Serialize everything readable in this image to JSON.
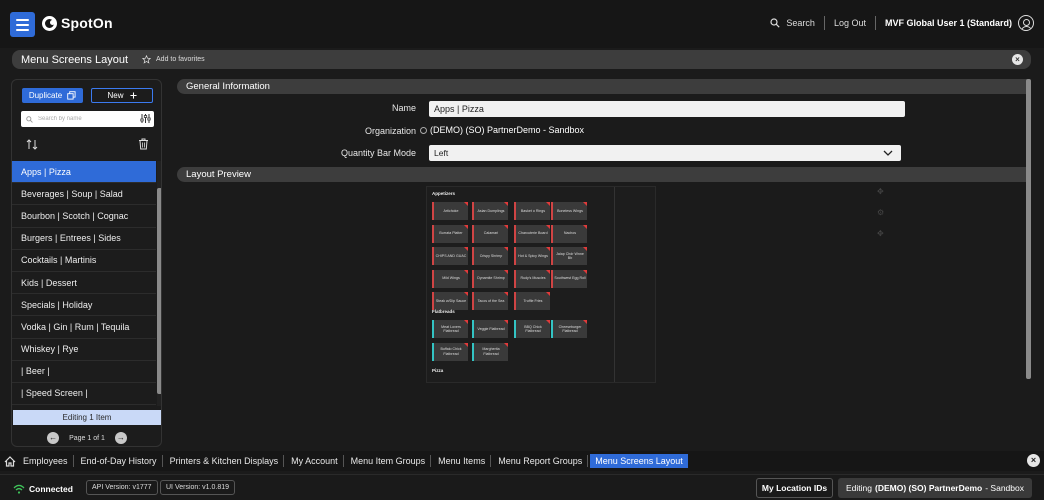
{
  "header": {
    "brand": "SpotOn",
    "search_label": "Search",
    "logout_label": "Log Out",
    "user_name": "MVF Global User 1 (Standard)"
  },
  "titlebar": {
    "title": "Menu Screens Layout",
    "favorites_label": "Add to favorites"
  },
  "sidebar": {
    "duplicate_label": "Duplicate",
    "new_label": "New",
    "search_placeholder": "Search by name",
    "items": [
      {
        "label": "Apps | Pizza",
        "active": true
      },
      {
        "label": "Beverages | Soup | Salad"
      },
      {
        "label": "Bourbon | Scotch | Cognac"
      },
      {
        "label": "Burgers | Entrees | Sides"
      },
      {
        "label": "Cocktails | Martinis"
      },
      {
        "label": "Kids | Dessert"
      },
      {
        "label": "Specials | Holiday"
      },
      {
        "label": "Vodka | Gin | Rum | Tequila"
      },
      {
        "label": "Whiskey | Rye"
      },
      {
        "label": "| Beer |"
      },
      {
        "label": "| Speed Screen |"
      }
    ],
    "editing_label": "Editing 1 Item",
    "pager_label": "Page 1 of 1"
  },
  "general": {
    "section_title": "General Information",
    "name_label": "Name",
    "name_value": "Apps | Pizza",
    "org_label": "Organization",
    "org_value": "(DEMO) (SO) PartnerDemo - Sandbox",
    "qty_label": "Quantity Bar Mode",
    "qty_value": "Left"
  },
  "preview": {
    "section_title": "Layout Preview",
    "groups": [
      {
        "heading": "Appetizers",
        "buttons": [
          "Artichoke",
          "Asian Dumplings",
          "Basket o Rings",
          "Boneless Wings",
          "Burrata Platter",
          "Calamari",
          "Charcuterie Board",
          "Nachos",
          "CHIPS AND GUAC",
          "Crispy Shrimp",
          "Hot & Spicy Wings",
          "Jalap Chdr Wnne Bb",
          "Mild Wings",
          "Dynamite Shrimp",
          "Rudy's Muscles",
          "Southwest Egg Roll",
          "Steak w/Dip Sauce",
          "Tacos of the Sea",
          "Truffle Fries"
        ]
      },
      {
        "heading": "Flatbreads",
        "buttons": [
          "Meat Lovers Flatbread",
          "Veggie Flatbread",
          "BBQ Chick Flatbread",
          "Cheeseburger Flatbread",
          "Buffalo Chick Flatbread",
          "Margherita Flatbread"
        ]
      },
      {
        "heading": "Pizza",
        "buttons": []
      }
    ]
  },
  "bottom_nav": {
    "items": [
      {
        "label": "Employees"
      },
      {
        "label": "End-of-Day History"
      },
      {
        "label": "Printers & Kitchen Displays"
      },
      {
        "label": "My Account"
      },
      {
        "label": "Menu Item Groups"
      },
      {
        "label": "Menu Items"
      },
      {
        "label": "Menu Report Groups"
      },
      {
        "label": "Menu Screens Layout",
        "active": true
      }
    ]
  },
  "status": {
    "connected": "Connected",
    "api_version": "API Version: v1777",
    "ui_version": "UI Version: v1.0.819",
    "location_button": "My Location IDs",
    "editing_prefix": "Editing",
    "editing_org": "(DEMO) (SO) PartnerDemo",
    "editing_suffix": "- Sandbox"
  },
  "colors": {
    "accent": "#2f6bd8",
    "panel": "#3d3d3d",
    "preview_red": "#d04444",
    "preview_teal": "#33c4c4"
  }
}
